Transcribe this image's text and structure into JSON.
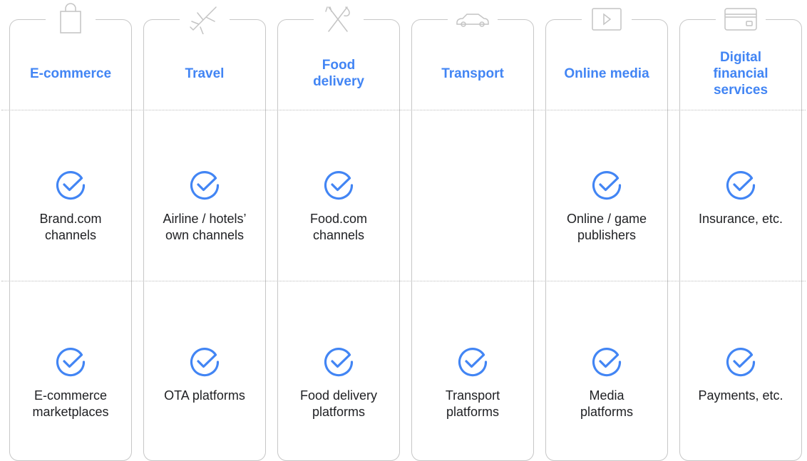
{
  "colors": {
    "accent": "#4285f4",
    "text": "#202124",
    "border": "#c7c7c7",
    "icon_stroke": "#c4c4c4"
  },
  "columns": [
    {
      "icon": "shopping-bag-icon",
      "title": "E-commerce",
      "row1": {
        "checked": true,
        "label": "Brand.com\nchannels"
      },
      "row2": {
        "checked": true,
        "label": "E-commerce\nmarketplaces"
      }
    },
    {
      "icon": "airplane-icon",
      "title": "Travel",
      "row1": {
        "checked": true,
        "label": "Airline / hotels’\nown channels"
      },
      "row2": {
        "checked": true,
        "label": "OTA platforms"
      }
    },
    {
      "icon": "fork-knife-icon",
      "title": "Food\ndelivery",
      "row1": {
        "checked": true,
        "label": "Food.com\nchannels"
      },
      "row2": {
        "checked": true,
        "label": "Food delivery\nplatforms"
      }
    },
    {
      "icon": "car-icon",
      "title": "Transport",
      "row1": {
        "checked": false,
        "label": ""
      },
      "row2": {
        "checked": true,
        "label": "Transport\nplatforms"
      }
    },
    {
      "icon": "video-play-icon",
      "title": "Online media",
      "row1": {
        "checked": true,
        "label": "Online / game\npublishers"
      },
      "row2": {
        "checked": true,
        "label": "Media\nplatforms"
      }
    },
    {
      "icon": "credit-card-icon",
      "title": "Digital\nfinancial\nservices",
      "row1": {
        "checked": true,
        "label": "Insurance, etc."
      },
      "row2": {
        "checked": true,
        "label": "Payments, etc."
      }
    }
  ]
}
